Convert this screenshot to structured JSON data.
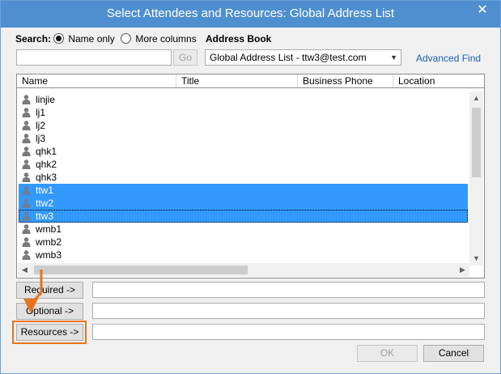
{
  "window": {
    "title": "Select Attendees and Resources: Global Address List",
    "close_glyph": "✕"
  },
  "search": {
    "label": "Search:",
    "option_name_only": "Name only",
    "option_more_columns": "More columns",
    "selected_option": "Name only",
    "input_value": "",
    "go_label": "Go"
  },
  "address_book": {
    "label": "Address Book",
    "selected": "Global Address List - ttw3@test.com",
    "advanced_find": "Advanced Find"
  },
  "list": {
    "columns": [
      "Name",
      "Title",
      "Business Phone",
      "Location"
    ],
    "rows": [
      {
        "name": "linjie",
        "selected": false
      },
      {
        "name": "lj1",
        "selected": false
      },
      {
        "name": "lj2",
        "selected": false
      },
      {
        "name": "lj3",
        "selected": false
      },
      {
        "name": "qhk1",
        "selected": false
      },
      {
        "name": "qhk2",
        "selected": false
      },
      {
        "name": "qhk3",
        "selected": false
      },
      {
        "name": "ttw1",
        "selected": true
      },
      {
        "name": "ttw2",
        "selected": true
      },
      {
        "name": "ttw3",
        "selected": true
      },
      {
        "name": "wmb1",
        "selected": false
      },
      {
        "name": "wmb2",
        "selected": false
      },
      {
        "name": "wmb3",
        "selected": false
      }
    ],
    "row_icon": "person-icon"
  },
  "fields": {
    "required_label": "Required ->",
    "optional_label": "Optional ->",
    "resources_label": "Resources ->",
    "required_value": "",
    "optional_value": "",
    "resources_value": ""
  },
  "footer": {
    "ok_label": "OK",
    "cancel_label": "Cancel"
  },
  "colors": {
    "titlebar": "#4f8fd0",
    "selection": "#3399ff",
    "annotation": "#e8731e"
  }
}
